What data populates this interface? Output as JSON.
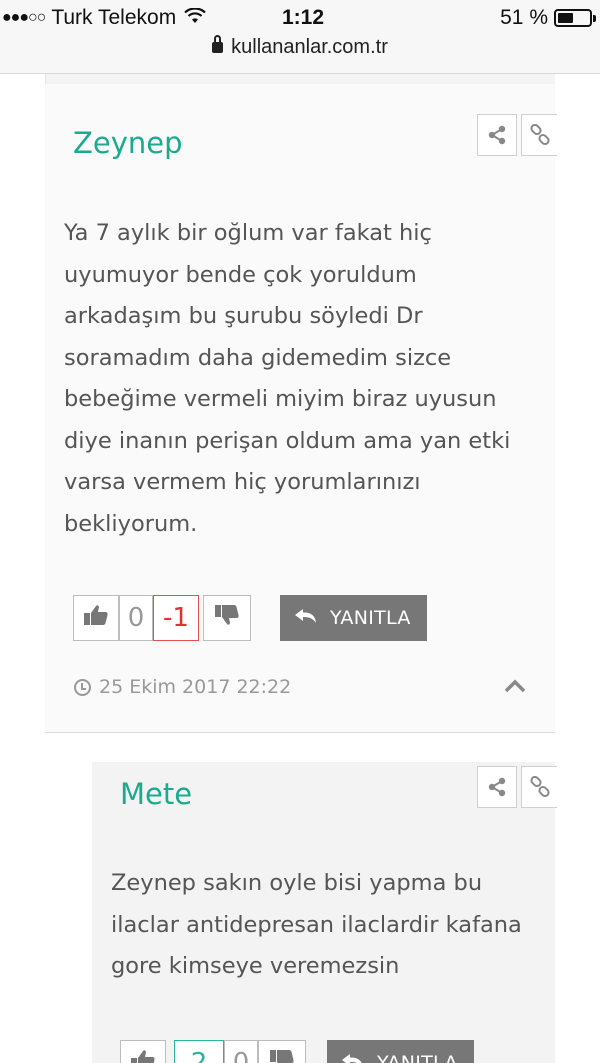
{
  "status_bar": {
    "signal_dots": "●●●○○",
    "carrier": "Turk Telekom",
    "wifi_icon": "wifi-icon",
    "time": "1:12",
    "battery_percent": "51 %",
    "battery_level": 0.51
  },
  "browser": {
    "url": "kullananlar.com.tr"
  },
  "comments": [
    {
      "author": "Zeynep",
      "text": "Ya 7 aylık bir oğlum var fakat hiç uyumuyor bende çok yoruldum arkadaşım bu şurubu söyledi Dr soramadım daha gidemedim sizce bebeğime vermeli miyim biraz uyusun diye inanın perişan oldum ama yan etki varsa vermem hiç yorumlarınızı bekliyorum.",
      "likes": "0",
      "dislikes": "-1",
      "reply_label": "YANITLA",
      "date": "25 Ekim 2017 22:22"
    },
    {
      "author": "Mete",
      "text": "Zeynep sakın oyle bisi yapma bu ilaclar antidepresan ilaclardir kafana gore kimseye veremezsin",
      "likes": "2",
      "dislikes": "0",
      "reply_label": "YANITLA"
    }
  ],
  "colors": {
    "accent": "#1aab8f",
    "negative": "#e03030",
    "reply_button": "#777777"
  }
}
